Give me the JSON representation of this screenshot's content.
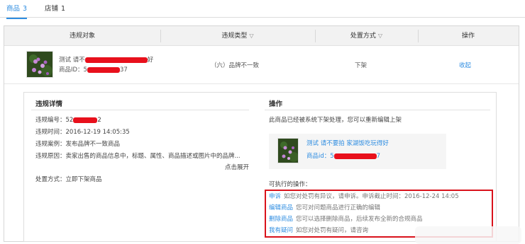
{
  "tabs": [
    {
      "label": "商品",
      "count": "3"
    },
    {
      "label": "店铺",
      "count": "1"
    }
  ],
  "table": {
    "headers": [
      "违规对象",
      "违规类型",
      "处置方式",
      "操作"
    ],
    "row": {
      "product_title_prefix": "测试 请不",
      "product_title_suffix": "好",
      "product_id_prefix": "商品ID：5",
      "product_id_suffix": "37",
      "violation_type": "（六）品牌不一致",
      "action_taken": "下架",
      "operation_link": "收起"
    }
  },
  "detail": {
    "title": "违规详情",
    "fields": {
      "number_prefix": "违规编号：52",
      "number_suffix": "2",
      "time": "违规时间：2016-12-19 14:05:35",
      "case": "违规案例：发布品牌不一致商品",
      "reason": "违规原因：卖家出售的商品信息中，标题、属性、商品描述或图片中的品牌...",
      "expand_link": "点击展开",
      "disposal": "处置方式：立即下架商品"
    }
  },
  "operations": {
    "title": "操作",
    "notice": "此商品已经被系统下架处理，您可以重新编辑上架",
    "product": {
      "title": "测试 请不要拍 家湖饭吃玩得好",
      "id_prefix": "商品id：5",
      "id_suffix": "7"
    },
    "executable_label": "可执行的操作：",
    "actions": [
      {
        "link": "申诉",
        "desc": "如您对处罚有异议，请申诉。申诉截止时间：2016-12-24 14:05"
      },
      {
        "link": "编辑商品",
        "desc": "您可对问题商品进行正确的编辑"
      },
      {
        "link": "删除商品",
        "desc": "您可以选择删除商品，后续发布全新的合规商品"
      },
      {
        "link": "我有疑问",
        "desc": "如您对处罚有疑问，请咨询"
      }
    ]
  },
  "colors": {
    "accent": "#2e8de1",
    "redaction": "#e8101c",
    "highlight_border": "#d9121b"
  }
}
